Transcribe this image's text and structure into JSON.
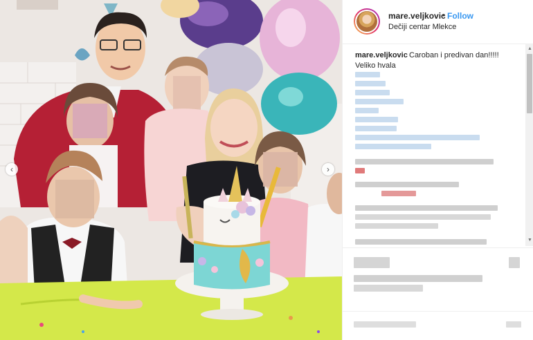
{
  "post": {
    "username": "mare.veljkovic",
    "separator": "•",
    "follow_label": "Follow",
    "location": "Dečiji centar Mlekce",
    "caption_username": "mare.veljkovic",
    "caption_line1": "Caroban i predivan dan!!!!!",
    "caption_line2": "Veliko hvala"
  },
  "navigation": {
    "prev_icon": "chevron-left-icon",
    "next_icon": "chevron-right-icon",
    "prev_glyph": "‹",
    "next_glyph": "›"
  },
  "scrollbar": {
    "up_glyph": "▲",
    "down_glyph": "▼"
  },
  "colors": {
    "link": "#3897f0",
    "text": "#262626",
    "cake_top": "#f7f4f0",
    "cake_bottom": "#7dd6d4",
    "table": "#d4e84a"
  }
}
